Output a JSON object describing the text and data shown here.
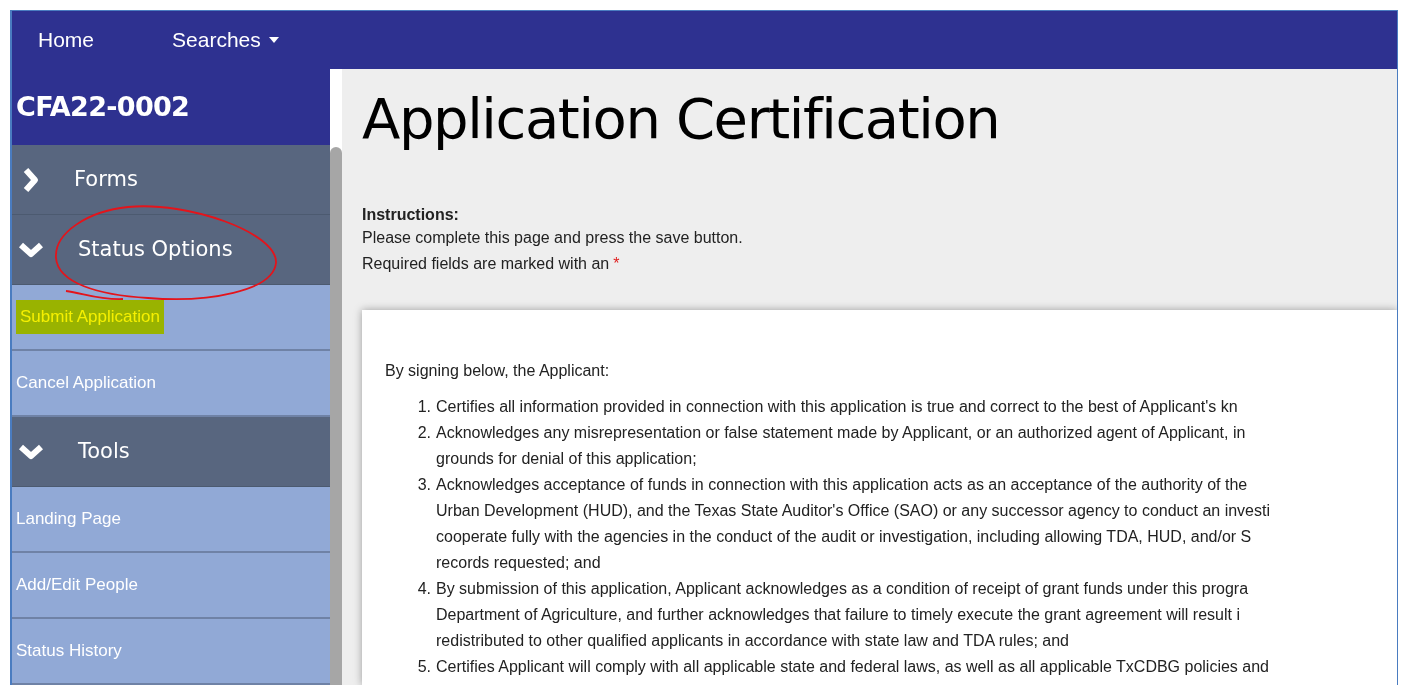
{
  "nav": [
    {
      "label": "Home",
      "kind": "link"
    },
    {
      "label": "Searches",
      "kind": "dropdown"
    }
  ],
  "sidebar": {
    "record_id": "CFA22-0002",
    "sections": [
      {
        "label": "Forms",
        "expanded": false,
        "circled": false
      },
      {
        "label": "Status Options",
        "expanded": true,
        "circled": true,
        "items": [
          {
            "label": "Submit Application",
            "highlighted": true
          },
          {
            "label": "Cancel Application",
            "highlighted": false
          }
        ]
      },
      {
        "label": "Tools",
        "expanded": true,
        "circled": false,
        "items": [
          {
            "label": "Landing Page",
            "highlighted": false
          },
          {
            "label": "Add/Edit People",
            "highlighted": false
          },
          {
            "label": "Status History",
            "highlighted": false
          }
        ]
      }
    ]
  },
  "page": {
    "title": "Application Certification",
    "instructions_heading": "Instructions:",
    "instructions": [
      "Please complete this page and press the save button.",
      "Required fields are marked with an"
    ],
    "required_mark": "*",
    "card": {
      "intro": "By signing below, the Applicant:",
      "list": [
        {
          "number": "1.",
          "lines": [
            "Certifies all information provided in connection with this application is true and correct to the best of Applicant's kn"
          ]
        },
        {
          "number": "2.",
          "lines": [
            "Acknowledges any misrepresentation or false statement made by Applicant, or an authorized agent of Applicant, in",
            "grounds for denial of this application;"
          ]
        },
        {
          "number": "3.",
          "lines": [
            "Acknowledges acceptance of funds in connection with this application acts as an acceptance of the authority of the",
            "Urban Development (HUD), and the Texas State Auditor's Office (SAO) or any successor agency to conduct an investi",
            "cooperate fully with the agencies in the conduct of the audit or investigation, including allowing TDA, HUD, and/or S",
            "records requested; and"
          ]
        },
        {
          "number": "4.",
          "lines": [
            "By submission of this application, Applicant acknowledges as a condition of receipt of grant funds under this progra",
            "Department of Agriculture, and further acknowledges that failure to timely execute the grant agreement will result i",
            "redistributed to other qualified applicants in accordance with state law and TDA rules; and"
          ]
        },
        {
          "number": "5.",
          "lines": [
            "Certifies Applicant will comply with all applicable state and federal laws, as well as all applicable TxCDBG policies and"
          ]
        }
      ]
    }
  }
}
